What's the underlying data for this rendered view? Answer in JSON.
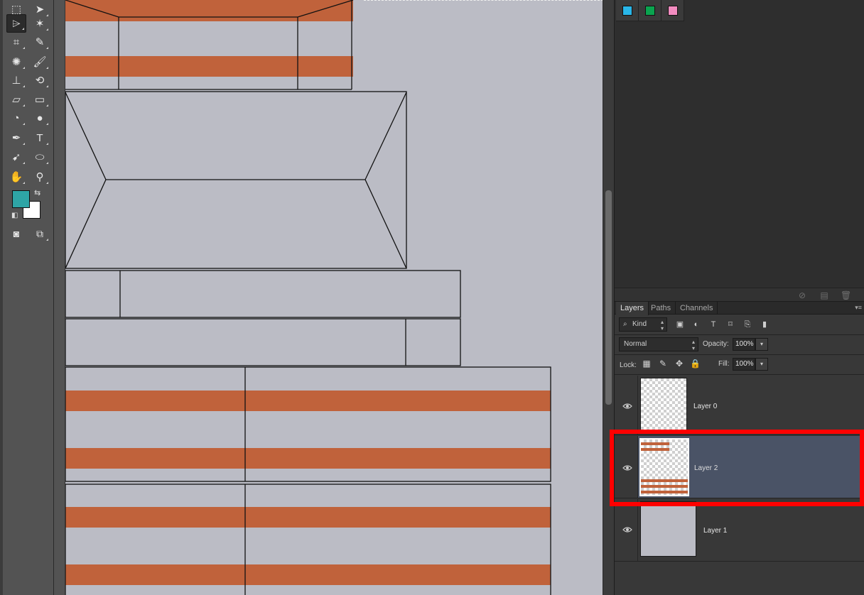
{
  "colors": {
    "foreground": "#2ea5a6",
    "background": "#ffffff",
    "canvas_bg": "#bbbcc5",
    "stripe": "#c0623b",
    "selected_layer": "#4a5366",
    "highlight": "#ff0000"
  },
  "toolbar": {
    "tools": [
      {
        "name": "rect-marquee-icon",
        "glyph": "⬚"
      },
      {
        "name": "move-icon",
        "glyph": "➤"
      },
      {
        "name": "polygonal-lasso-icon",
        "glyph": "⌲"
      },
      {
        "name": "magic-wand-icon",
        "glyph": "✶"
      },
      {
        "name": "crop-icon",
        "glyph": "⌗"
      },
      {
        "name": "eyedropper-icon",
        "glyph": "✎"
      },
      {
        "name": "spot-healing-icon",
        "glyph": "✺"
      },
      {
        "name": "brush-icon",
        "glyph": "🖌"
      },
      {
        "name": "clone-stamp-icon",
        "glyph": "⊥"
      },
      {
        "name": "history-brush-icon",
        "glyph": "⟲"
      },
      {
        "name": "eraser-icon",
        "glyph": "▱"
      },
      {
        "name": "gradient-icon",
        "glyph": "▭"
      },
      {
        "name": "blur-icon",
        "glyph": "◔"
      },
      {
        "name": "dodge-icon",
        "glyph": "●"
      },
      {
        "name": "pen-icon",
        "glyph": "✒"
      },
      {
        "name": "type-icon",
        "glyph": "T"
      },
      {
        "name": "path-selection-icon",
        "glyph": "➹"
      },
      {
        "name": "ellipse-icon",
        "glyph": "⬭"
      },
      {
        "name": "hand-icon",
        "glyph": "✋"
      },
      {
        "name": "zoom-icon",
        "glyph": "⚲"
      }
    ],
    "swap_glyph": "⇆",
    "reset_glyph": "◧",
    "quick_mask_glyph": "◙",
    "screen_mode_glyph": "⧉"
  },
  "swatches": [
    "#29b6e8",
    "#0aa44f",
    "#f28cc0"
  ],
  "layers_panel": {
    "tabs": [
      "Layers",
      "Paths",
      "Channels"
    ],
    "active_tab": "Layers",
    "menu_glyph": "▾≡",
    "filter_label": "Kind",
    "filter_icons": [
      "image-filter-icon",
      "adjustment-filter-icon",
      "type-filter-icon",
      "shape-filter-icon",
      "smart-object-filter-icon",
      "filter-toggle-icon"
    ],
    "filter_glyphs": [
      "▣",
      "◐",
      "T",
      "⌑",
      "⎘",
      "▮"
    ],
    "blend_mode": "Normal",
    "opacity_label": "Opacity:",
    "opacity_value": "100%",
    "lock_label": "Lock:",
    "lock_glyphs": [
      "▦",
      "✎",
      "✥",
      "🔒"
    ],
    "fill_label": "Fill:",
    "fill_value": "100%",
    "layers": [
      {
        "name": "Layer 0",
        "visible": true,
        "selected": false
      },
      {
        "name": "Layer 2",
        "visible": true,
        "selected": true
      },
      {
        "name": "Layer 1",
        "visible": true,
        "selected": false
      }
    ]
  },
  "upper_panel_footer_glyphs": [
    "⊘",
    "▤",
    "🗑"
  ]
}
